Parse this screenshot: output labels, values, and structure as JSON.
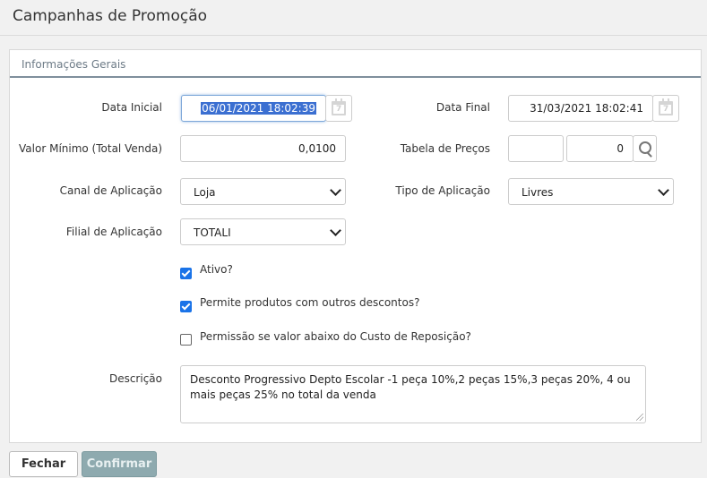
{
  "page": {
    "title": "Campanhas de Promoção"
  },
  "panel": {
    "heading": "Informações Gerais"
  },
  "form": {
    "data_inicial": {
      "label": "Data Inicial",
      "value": "06/01/2021 18:02:39"
    },
    "data_final": {
      "label": "Data Final",
      "value": "31/03/2021 18:02:41"
    },
    "valor_minimo": {
      "label": "Valor Mínimo (Total Venda)",
      "value": "0,0100"
    },
    "tabela_precos": {
      "label": "Tabela de Preços",
      "code": "",
      "value": "0"
    },
    "canal": {
      "label": "Canal de Aplicação",
      "value": "Loja"
    },
    "tipo": {
      "label": "Tipo de Aplicação",
      "value": "Livres"
    },
    "filial": {
      "label": "Filial de Aplicação",
      "value": "TOTALI"
    },
    "ativo": {
      "label": "Ativo?",
      "checked": true
    },
    "permite_descontos": {
      "label": "Permite produtos com outros descontos?",
      "checked": true
    },
    "permissao_custo": {
      "label": "Permissão se valor abaixo do Custo de Reposição?",
      "checked": false
    },
    "descricao": {
      "label": "Descrição",
      "value": "Desconto Progressivo Depto Escolar -1 peça 10%,2 peças 15%,3 peças 20%, 4 ou mais peças 25% no total da venda"
    }
  },
  "calendar_icon_text": "7",
  "buttons": {
    "fechar": "Fechar",
    "confirmar": "Confirmar"
  },
  "icons": {
    "calendar": "calendar-icon",
    "search": "search-icon",
    "chevron": "chevron-down-icon",
    "check": "checkmark-icon",
    "resize": "resize-grip-icon"
  },
  "colors": {
    "accent": "#1a73e8",
    "confirm_button": "#8eaaaf",
    "panel_border": "#7f8f9c",
    "selection": "#3b6fd1"
  }
}
